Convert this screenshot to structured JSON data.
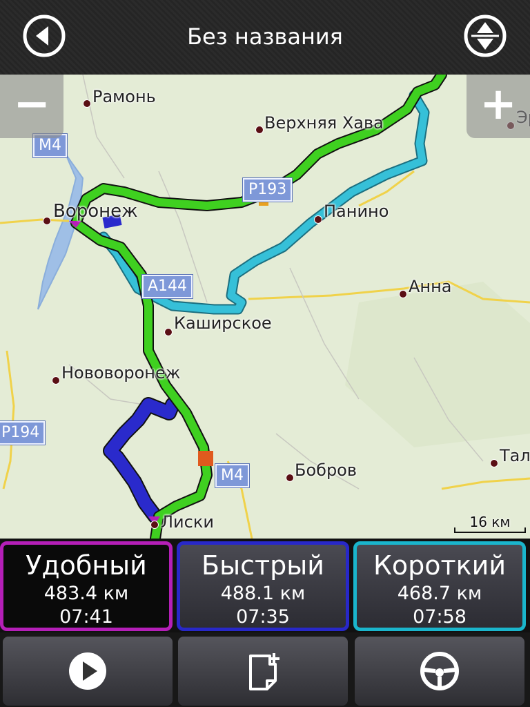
{
  "header": {
    "title": "Без названия"
  },
  "map": {
    "places": [
      {
        "id": "ramon",
        "label": "Рамонь"
      },
      {
        "id": "verkhnyaya-khava",
        "label": "Верхняя Хава"
      },
      {
        "id": "voronezh",
        "label": "Воронеж"
      },
      {
        "id": "panino",
        "label": "Панино"
      },
      {
        "id": "anna",
        "label": "Анна"
      },
      {
        "id": "kashirskoe",
        "label": "Каширское"
      },
      {
        "id": "novovoronezh",
        "label": "Нововоронеж"
      },
      {
        "id": "bobrov",
        "label": "Бобров"
      },
      {
        "id": "liski",
        "label": "Лиски"
      },
      {
        "id": "er",
        "label": "Эр"
      },
      {
        "id": "tal",
        "label": "Тал"
      }
    ],
    "shields": [
      {
        "id": "m4-top",
        "label": "М4"
      },
      {
        "id": "r193",
        "label": "Р193"
      },
      {
        "id": "a144",
        "label": "А144"
      },
      {
        "id": "r194",
        "label": "Р194"
      },
      {
        "id": "m4-bottom",
        "label": "М4"
      }
    ],
    "zoom_out_label": "−",
    "zoom_in_label": "+",
    "scale_label": "16 км"
  },
  "routes": [
    {
      "name": "Удобный",
      "distance": "483.4 км",
      "time": "07:41",
      "color": "#b51fb8",
      "selected": true
    },
    {
      "name": "Быстрый",
      "distance": "488.1 км",
      "time": "07:35",
      "color": "#2828c8",
      "selected": false
    },
    {
      "name": "Короткий",
      "distance": "468.7 км",
      "time": "07:58",
      "color": "#1ab5cc",
      "selected": false
    }
  ],
  "colors": {
    "route_green": "#33cc22",
    "route_blue": "#2222cc",
    "route_cyan": "#33b8d0"
  },
  "toolbar": {
    "icons": [
      "play-icon",
      "add-note-icon",
      "steering-wheel-icon"
    ]
  }
}
